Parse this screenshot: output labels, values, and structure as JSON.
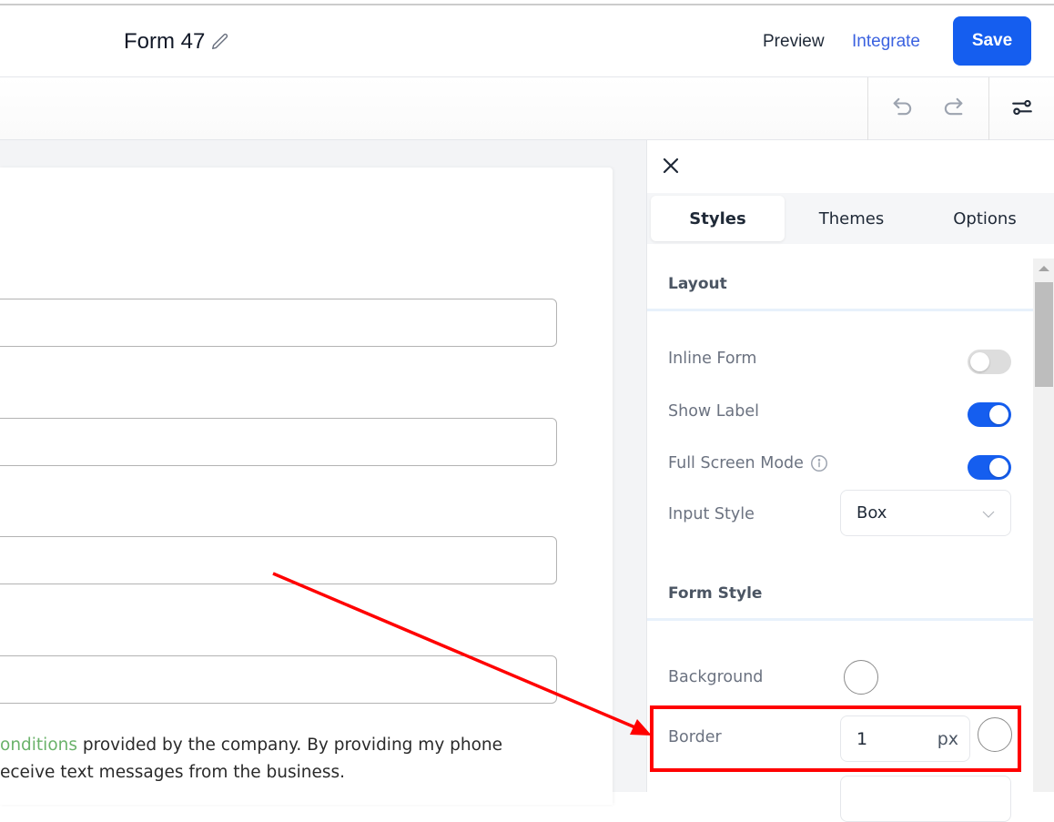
{
  "header": {
    "form_title": "Form 47",
    "edit_icon": "pencil-icon",
    "preview_label": "Preview",
    "integrate_label": "Integrate",
    "save_label": "Save",
    "colors": {
      "primary": "#155eef",
      "integrate": "#3b62e0"
    }
  },
  "toolbar": {
    "undo_icon": "undo-icon",
    "redo_icon": "redo-icon",
    "settings_icon": "sliders-icon"
  },
  "canvas": {
    "inputs": [
      {},
      {},
      {},
      {}
    ],
    "consent": {
      "line1_link": "onditions",
      "line1_rest": " provided by the company. By providing my phone",
      "line2": "eceive text messages from the business.",
      "link_color": "#6ab26a"
    }
  },
  "panel": {
    "close_icon": "close-icon",
    "tabs": [
      {
        "label": "Styles",
        "active": true
      },
      {
        "label": "Themes",
        "active": false
      },
      {
        "label": "Options",
        "active": false
      }
    ],
    "sections": {
      "layout": {
        "title": "Layout",
        "inline_form": {
          "label": "Inline Form",
          "enabled": false
        },
        "show_label": {
          "label": "Show Label",
          "enabled": true
        },
        "full_screen_mode": {
          "label": "Full Screen Mode",
          "enabled": true,
          "info_icon": "info-icon"
        },
        "input_style": {
          "label": "Input Style",
          "value": "Box"
        }
      },
      "form_style": {
        "title": "Form Style",
        "background": {
          "label": "Background",
          "color": "#ffffff"
        },
        "border": {
          "label": "Border",
          "value": "1",
          "unit": "px",
          "color": "#ffffff"
        }
      }
    }
  },
  "annotation": {
    "color": "#ff0000",
    "target": "Border"
  }
}
